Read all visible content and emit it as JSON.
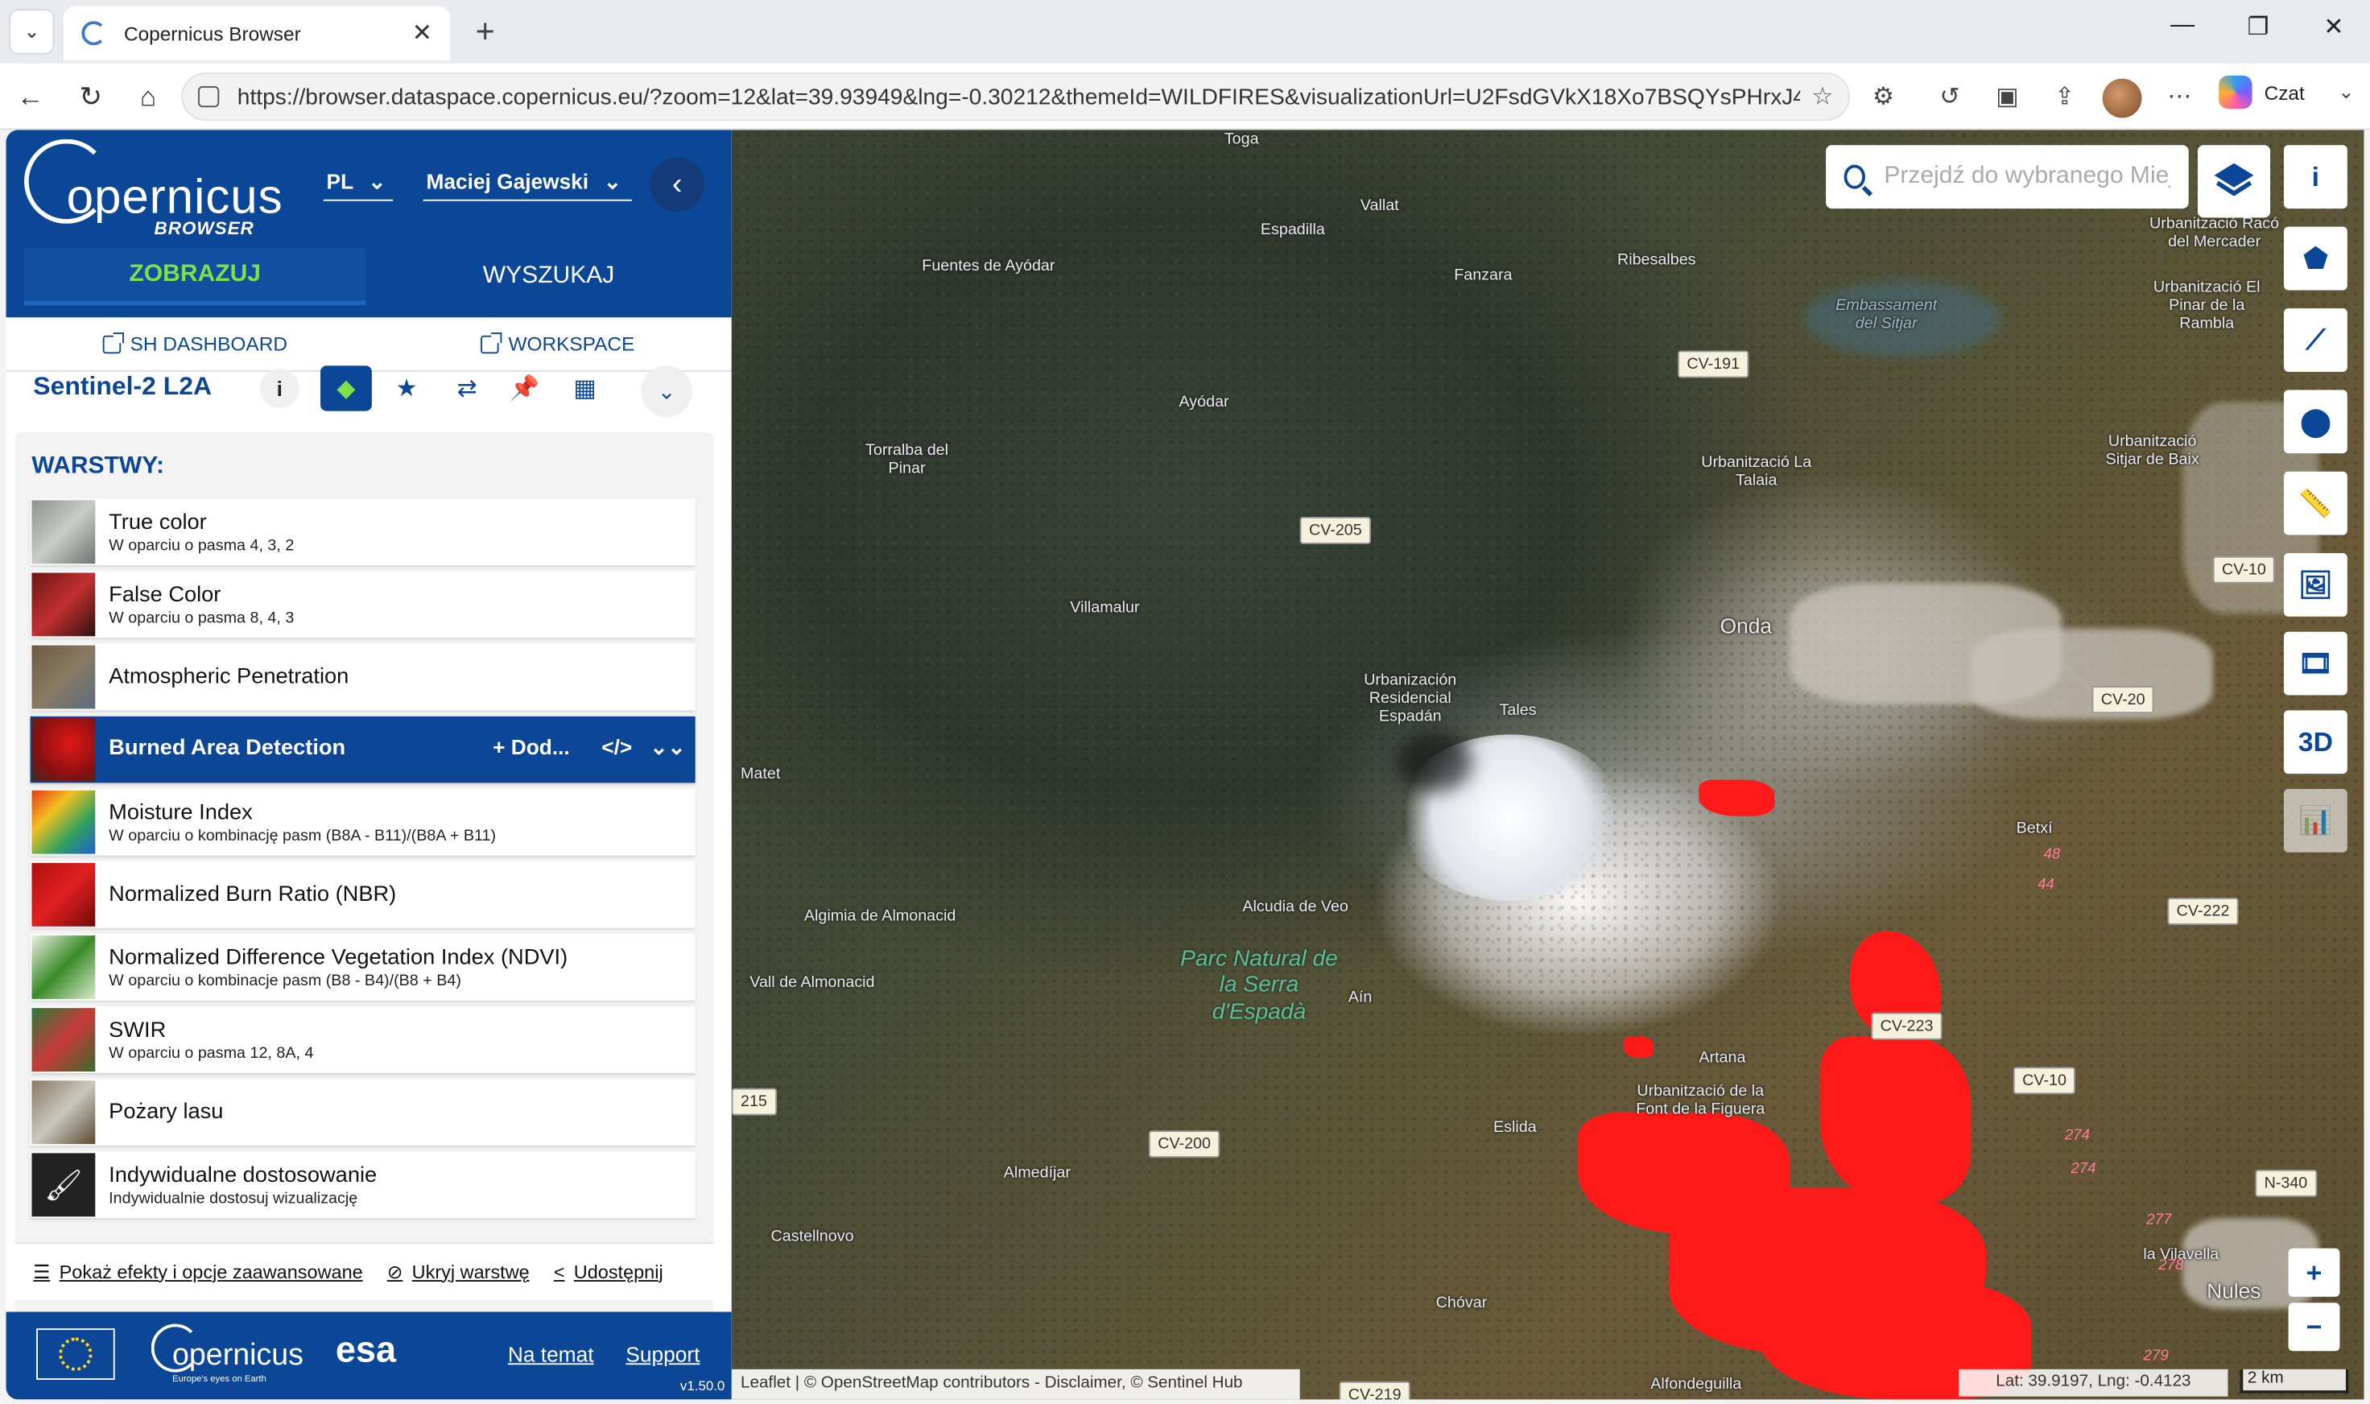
{
  "browser": {
    "tab_title": "Copernicus Browser",
    "url": "https://browser.dataspace.copernicus.eu/?zoom=12&lat=39.93949&lng=-0.30212&themeId=WILDFIRES&visualizationUrl=U2FsdGVkX18Xo7BSQYsPHrxJ4J...",
    "copilot_label": "Czat"
  },
  "panel": {
    "logo_word": "opernicus",
    "logo_sub": "BROWSER",
    "lang": "PL",
    "user": "Maciej Gajewski",
    "tabs": [
      "ZOBRAZUJ",
      "WYSZUKAJ"
    ],
    "links": [
      "SH DASHBOARD",
      "WORKSPACE"
    ],
    "dataset": "Sentinel-2 L2A",
    "layers_title": "WARSTWY:",
    "layers": [
      {
        "name": "True color",
        "desc": "W oparciu o pasma 4, 3, 2"
      },
      {
        "name": "False Color",
        "desc": "W oparciu o pasma 8, 4, 3"
      },
      {
        "name": "Atmospheric Penetration",
        "desc": ""
      },
      {
        "name": "Burned Area Detection",
        "desc": ""
      },
      {
        "name": "Moisture Index",
        "desc": "W oparciu o kombinację pasm (B8A - B11)/(B8A + B11)"
      },
      {
        "name": "Normalized Burn Ratio (NBR)",
        "desc": ""
      },
      {
        "name": "Normalized Difference Vegetation Index (NDVI)",
        "desc": "W oparciu o kombinacje pasm (B8 - B4)/(B8 + B4)"
      },
      {
        "name": "SWIR",
        "desc": "W oparciu o pasma 12, 8A, 4"
      },
      {
        "name": "Pożary lasu",
        "desc": ""
      },
      {
        "name": "Indywidualne dostosowanie",
        "desc": "Indywidualnie dostosuj wizualizację"
      }
    ],
    "selected_actions": {
      "add": "+ Dod...",
      "code": "</>"
    },
    "footer_links": [
      "Pokaż efekty i opcje zaawansowane",
      "Ukryj warstwę",
      "Udostępnij"
    ],
    "bottom": {
      "about": "Na temat",
      "support": "Support",
      "version": "v1.50.0",
      "esa": "esa",
      "cop_word": "opernicus",
      "cop_sub": "Europe's eyes on Earth"
    }
  },
  "map": {
    "search_placeholder": "Przejdź do wybranego Miejsca",
    "tool_3d": "3D",
    "attribution": "Leaflet | © OpenStreetMap contributors - Disclaimer, © Sentinel Hub",
    "coords": "Lat: 39.9197, Lng: -0.4123",
    "scale": "2 km",
    "labels": [
      "Toga",
      "Vallat",
      "Espadilla",
      "Fuentes de Ayódar",
      "Fanzara",
      "Ribesalbes",
      "Embassament del Sitjar",
      "Ayódar",
      "Torralba del Pinar",
      "Urbanització La Talaia",
      "Urbanització Sitjar de Baix",
      "Urbanització Racó del Mercader",
      "Urbanització El Pinar de la Rambla",
      "Villamalur",
      "Onda",
      "Urbanización Residencial Espadán",
      "Tales",
      "Matet",
      "Betxí",
      "Algimia de Almonacid",
      "Alcudia de Veo",
      "Vall de Almonacid",
      "Aín",
      "Artana",
      "Urbanització de la Font de la Figuera",
      "Eslida",
      "Almedíjar",
      "Castellnovo",
      "Chóvar",
      "Alfondeguilla",
      "la Vilavella",
      "Nules"
    ],
    "park": "Parc Natural de la Serra d'Espadà",
    "roads": [
      "CV-191",
      "CV-205",
      "CV-10",
      "CV-20",
      "CV-222",
      "CV-223",
      "CV-10",
      "CV-200",
      "N-340",
      "215",
      "CV-219"
    ],
    "road_nums": [
      "48",
      "44",
      "274",
      "274",
      "277",
      "278",
      "279"
    ]
  },
  "colors": {
    "brand": "#0b4697",
    "accent": "#7fe04a",
    "burn": "#ff1a1a"
  }
}
